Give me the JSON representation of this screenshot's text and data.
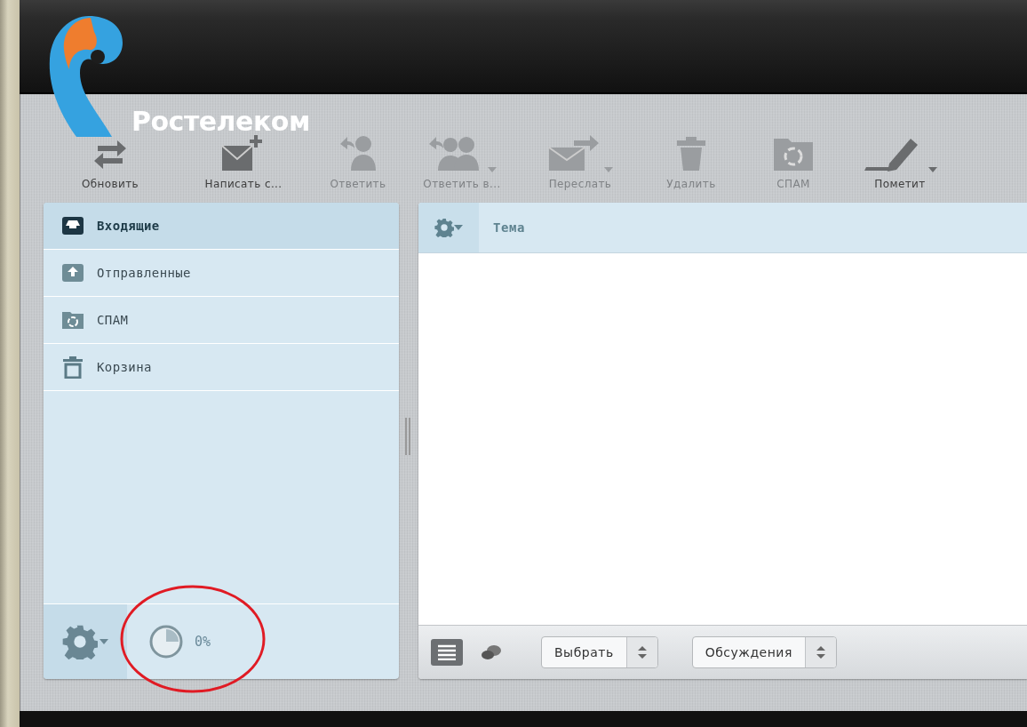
{
  "brand": {
    "name": "Ростелеком"
  },
  "toolbar": [
    {
      "kind": "refresh",
      "label": "Обновить",
      "disabled": false,
      "dropdown": false
    },
    {
      "kind": "compose",
      "label": "Написать с...",
      "disabled": false,
      "dropdown": false
    },
    {
      "kind": "reply",
      "label": "Ответить",
      "disabled": true,
      "dropdown": false
    },
    {
      "kind": "reply_all",
      "label": "Ответить в...",
      "disabled": true,
      "dropdown": true
    },
    {
      "kind": "forward",
      "label": "Переслать",
      "disabled": true,
      "dropdown": true
    },
    {
      "kind": "delete",
      "label": "Удалить",
      "disabled": true,
      "dropdown": false
    },
    {
      "kind": "spam",
      "label": "СПАМ",
      "disabled": true,
      "dropdown": false
    },
    {
      "kind": "mark",
      "label": "Пометит",
      "disabled": false,
      "dropdown": true
    }
  ],
  "folders": [
    {
      "kind": "inbox",
      "label": "Входящие",
      "selected": true
    },
    {
      "kind": "sent",
      "label": "Отправленные",
      "selected": false
    },
    {
      "kind": "spam",
      "label": "СПАМ",
      "selected": false
    },
    {
      "kind": "trash",
      "label": "Корзина",
      "selected": false
    }
  ],
  "quota": {
    "text": "0%"
  },
  "message_list": {
    "columns": [
      "Тема"
    ]
  },
  "bottom_bar": {
    "views": [
      {
        "kind": "list",
        "selected": true
      },
      {
        "kind": "threads",
        "selected": false
      }
    ],
    "selects": [
      {
        "value": "Выбрать"
      },
      {
        "value": "Обсуждения"
      }
    ]
  }
}
